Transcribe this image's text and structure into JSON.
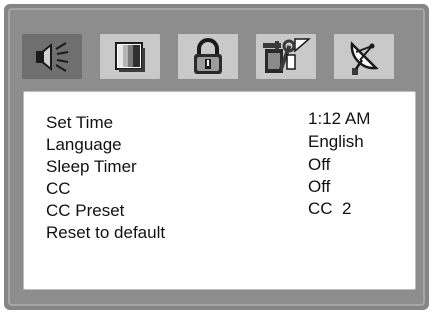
{
  "tabs": [
    {
      "icon": "speaker-icon",
      "active": true
    },
    {
      "icon": "video-icon",
      "active": false
    },
    {
      "icon": "lock-icon",
      "active": false
    },
    {
      "icon": "tools-icon",
      "active": false
    },
    {
      "icon": "satellite-dish-icon",
      "active": false
    }
  ],
  "menu": {
    "items": [
      {
        "label": "Set Time",
        "value": "1:12 AM"
      },
      {
        "label": "Language",
        "value": "English"
      },
      {
        "label": "Sleep Timer",
        "value": "Off"
      },
      {
        "label": "CC",
        "value": "Off"
      },
      {
        "label": "CC Preset",
        "value": "CC  2"
      },
      {
        "label": "Reset to default",
        "value": ""
      }
    ]
  },
  "colors": {
    "frame": "#858585",
    "tab_active": "#6f6f6f",
    "tab_inactive": "#c9c9c9",
    "panel": "#ffffff",
    "text": "#111111"
  }
}
